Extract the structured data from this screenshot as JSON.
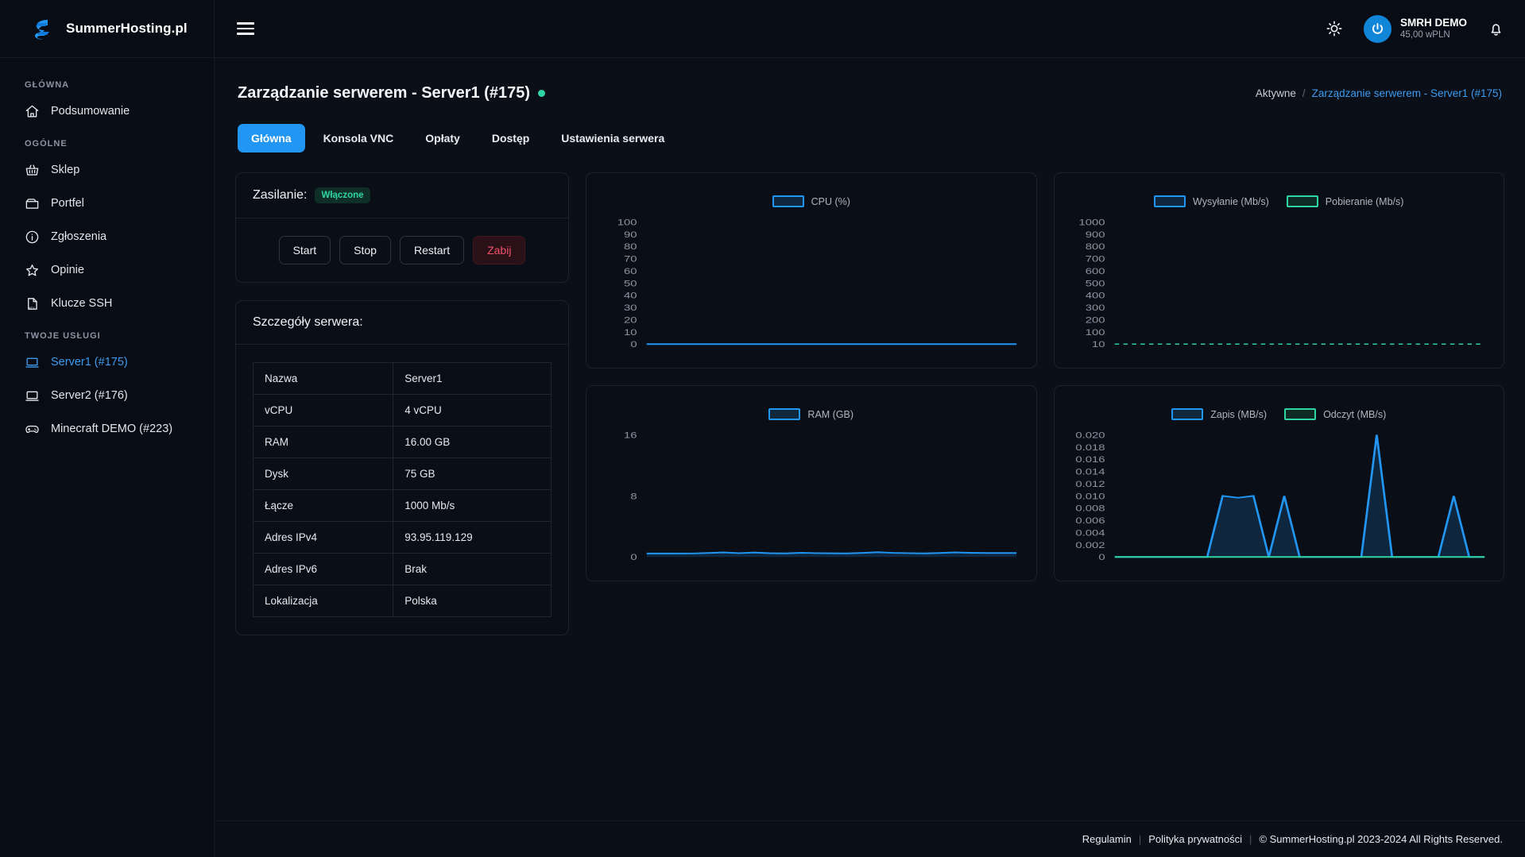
{
  "brand": {
    "name": "SummerHosting.pl",
    "logo_icon": "summer-hosting-logo"
  },
  "sidebar": {
    "sections": [
      {
        "label": "GŁÓWNA",
        "items": [
          {
            "label": "Podsumowanie",
            "icon": "home-icon",
            "active": false
          }
        ]
      },
      {
        "label": "OGÓLNE",
        "items": [
          {
            "label": "Sklep",
            "icon": "basket-icon",
            "active": false
          },
          {
            "label": "Portfel",
            "icon": "wallet-icon",
            "active": false
          },
          {
            "label": "Zgłoszenia",
            "icon": "info-circle-icon",
            "active": false
          },
          {
            "label": "Opinie",
            "icon": "star-icon",
            "active": false
          },
          {
            "label": "Klucze SSH",
            "icon": "key-file-icon",
            "active": false
          }
        ]
      },
      {
        "label": "TWOJE USŁUGI",
        "items": [
          {
            "label": "Server1 (#175)",
            "icon": "laptop-icon",
            "active": true
          },
          {
            "label": "Server2 (#176)",
            "icon": "laptop-icon",
            "active": false
          },
          {
            "label": "Minecraft DEMO (#223)",
            "icon": "gamepad-icon",
            "active": false
          }
        ]
      }
    ]
  },
  "topbar": {
    "menu_icon": "hamburger-icon",
    "theme_icon": "sun-icon",
    "notifications_icon": "bell-icon",
    "avatar_icon": "power-avatar-icon",
    "user_name": "SMRH DEMO",
    "user_balance": "45,00 wPLN"
  },
  "page": {
    "title": "Zarządzanie serwerem - Server1 (#175)",
    "status_color": "#2fd6a4",
    "breadcrumb": {
      "root": "Aktywne",
      "separator": "/",
      "current": "Zarządzanie serwerem - Server1 (#175)"
    }
  },
  "tabs": [
    {
      "label": "Główna",
      "active": true
    },
    {
      "label": "Konsola VNC",
      "active": false
    },
    {
      "label": "Opłaty",
      "active": false
    },
    {
      "label": "Dostęp",
      "active": false
    },
    {
      "label": "Ustawienia serwera",
      "active": false
    }
  ],
  "power": {
    "title": "Zasilanie:",
    "status": "Włączone",
    "buttons": [
      {
        "label": "Start",
        "variant": "default"
      },
      {
        "label": "Stop",
        "variant": "default"
      },
      {
        "label": "Restart",
        "variant": "default"
      },
      {
        "label": "Zabij",
        "variant": "danger"
      }
    ]
  },
  "details": {
    "title": "Szczegóły serwera:",
    "rows": [
      {
        "key": "Nazwa",
        "value": "Server1"
      },
      {
        "key": "vCPU",
        "value": "4 vCPU"
      },
      {
        "key": "RAM",
        "value": "16.00 GB"
      },
      {
        "key": "Dysk",
        "value": "75 GB"
      },
      {
        "key": "Łącze",
        "value": "1000 Mb/s"
      },
      {
        "key": "Adres IPv4",
        "value": "93.95.119.129"
      },
      {
        "key": "Adres IPv6",
        "value": "Brak"
      },
      {
        "key": "Lokalizacja",
        "value": "Polska"
      }
    ]
  },
  "chart_data": [
    {
      "id": "cpu",
      "type": "line",
      "title": "",
      "legend": [
        {
          "name": "CPU (%)",
          "color": "#2196f3"
        }
      ],
      "ylabel": "",
      "xlabel": "",
      "ylim": [
        0,
        100
      ],
      "yticks": [
        100,
        90,
        80,
        70,
        60,
        50,
        40,
        30,
        20,
        10,
        0
      ],
      "grid": false,
      "legend_position": "top-center",
      "series": [
        {
          "name": "CPU (%)",
          "color": "#2196f3",
          "values": [
            0,
            0,
            0,
            0,
            0,
            0,
            0,
            0,
            0,
            0,
            0,
            0,
            0,
            0,
            0,
            0,
            0,
            0,
            0,
            0,
            0,
            0,
            0,
            0,
            0
          ]
        }
      ]
    },
    {
      "id": "network",
      "type": "line",
      "title": "",
      "legend": [
        {
          "name": "Wysyłanie (Mb/s)",
          "color": "#2196f3"
        },
        {
          "name": "Pobieranie (Mb/s)",
          "color": "#2fd6a4"
        }
      ],
      "ylabel": "",
      "xlabel": "",
      "ylim": [
        10,
        1000
      ],
      "yticks": [
        1000,
        900,
        800,
        700,
        600,
        500,
        400,
        300,
        200,
        100,
        10
      ],
      "grid": false,
      "legend_position": "top-center",
      "series": [
        {
          "name": "Wysyłanie (Mb/s)",
          "color": "#2196f3",
          "values": [
            10,
            10,
            10,
            10,
            10,
            10,
            10,
            10,
            10,
            10,
            10,
            10,
            10,
            10,
            10,
            10,
            10,
            10,
            10,
            10,
            10,
            10,
            10,
            10,
            10
          ]
        },
        {
          "name": "Pobieranie (Mb/s)",
          "color": "#2fd6a4",
          "values": [
            10,
            10,
            10,
            10,
            10,
            10,
            10,
            10,
            10,
            10,
            10,
            10,
            10,
            10,
            10,
            10,
            10,
            10,
            10,
            10,
            10,
            10,
            10,
            10,
            10
          ]
        }
      ]
    },
    {
      "id": "ram",
      "type": "area",
      "title": "",
      "legend": [
        {
          "name": "RAM (GB)",
          "color": "#2196f3"
        }
      ],
      "ylabel": "",
      "xlabel": "",
      "ylim": [
        0,
        16
      ],
      "yticks": [
        16,
        8,
        0
      ],
      "grid": false,
      "legend_position": "top-center",
      "series": [
        {
          "name": "RAM (GB)",
          "color": "#2196f3",
          "values": [
            0.45,
            0.45,
            0.45,
            0.46,
            0.52,
            0.6,
            0.5,
            0.58,
            0.49,
            0.47,
            0.55,
            0.5,
            0.48,
            0.47,
            0.53,
            0.62,
            0.54,
            0.5,
            0.47,
            0.52,
            0.6,
            0.55,
            0.52,
            0.52,
            0.52
          ]
        }
      ]
    },
    {
      "id": "disk",
      "type": "area",
      "title": "",
      "legend": [
        {
          "name": "Zapis (MB/s)",
          "color": "#2196f3"
        },
        {
          "name": "Odczyt (MB/s)",
          "color": "#2fd6a4"
        }
      ],
      "ylabel": "",
      "xlabel": "",
      "ylim": [
        0,
        0.02
      ],
      "yticks": [
        "0.020",
        "0.018",
        "0.016",
        "0.014",
        "0.012",
        "0.010",
        "0.008",
        "0.006",
        "0.004",
        "0.002",
        "0"
      ],
      "grid": false,
      "legend_position": "top-center",
      "series": [
        {
          "name": "Zapis (MB/s)",
          "color": "#2196f3",
          "values": [
            0,
            0,
            0,
            0,
            0,
            0,
            0,
            0.01,
            0.0097,
            0.01,
            0,
            0.01,
            0,
            0,
            0,
            0,
            0,
            0.02,
            0,
            0,
            0,
            0,
            0.01,
            0,
            0
          ]
        },
        {
          "name": "Odczyt (MB/s)",
          "color": "#2fd6a4",
          "values": [
            0,
            0,
            0,
            0,
            0,
            0,
            0,
            0,
            0,
            0,
            0,
            0,
            0,
            0,
            0,
            0,
            0,
            0,
            0,
            0,
            0,
            0,
            0,
            0,
            0
          ]
        }
      ]
    }
  ],
  "footer": {
    "terms": "Regulamin",
    "privacy": "Polityka prywatności",
    "copyright": "© SummerHosting.pl 2023-2024 All Rights Reserved."
  }
}
